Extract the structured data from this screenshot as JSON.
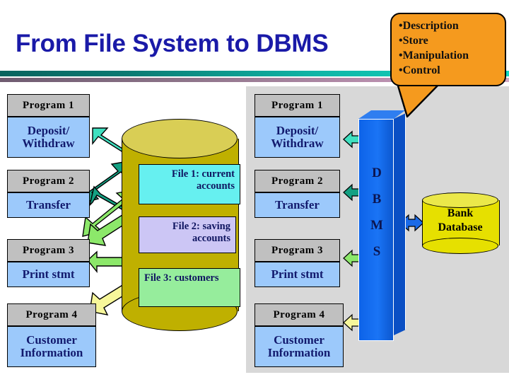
{
  "slide": {
    "title": "From File System to DBMS"
  },
  "callout": {
    "name": "dbms-functions-callout",
    "color": "#f59a1e",
    "items": [
      "Description",
      "Store",
      "Manipulation",
      "Control"
    ],
    "bullet": "•"
  },
  "left_column": {
    "label": "file-system-programs",
    "programs": [
      {
        "header": "Program 1",
        "body_lines": [
          "Deposit/",
          "Withdraw"
        ]
      },
      {
        "header": "Program 2",
        "body_lines": [
          "Transfer"
        ]
      },
      {
        "header": "Program 3",
        "body_lines": [
          "Print stmt"
        ]
      },
      {
        "header": "Program 4",
        "body_lines": [
          "Customer",
          "Information"
        ]
      }
    ]
  },
  "right_column": {
    "label": "dbms-programs",
    "programs": [
      {
        "header": "Program 1",
        "body_lines": [
          "Deposit/",
          "Withdraw"
        ]
      },
      {
        "header": "Program 2",
        "body_lines": [
          "Transfer"
        ]
      },
      {
        "header": "Program 3",
        "body_lines": [
          "Print stmt"
        ]
      },
      {
        "header": "Program 4",
        "body_lines": [
          "Customer",
          "Information"
        ]
      }
    ]
  },
  "file_cylinder": {
    "label": "file-system-store",
    "color": "#bfb000",
    "top_color": "#d9ce55",
    "files": [
      {
        "lines": [
          "File 1: current",
          "accounts"
        ],
        "color": "#66f0f0"
      },
      {
        "lines": [
          "File 2: saving",
          "accounts"
        ],
        "color": "#ccc6f5"
      },
      {
        "lines": [
          "File 3:",
          "customers"
        ],
        "color": "#96ed9c"
      }
    ]
  },
  "dbms": {
    "label": "DBMS",
    "letters": [
      "D",
      "B",
      "M",
      "S"
    ],
    "color": "#1a74f5"
  },
  "bank_database": {
    "lines": [
      "Bank",
      "Database"
    ],
    "color": "#e6e000"
  },
  "arrow_colors": {
    "teal_light": "#3fe0c0",
    "teal_dark": "#14a082",
    "green": "#8ce86a",
    "yellow": "#f7f79a",
    "blue": "#1a6ae8"
  },
  "banner": {
    "teal_from": "#09635e",
    "teal_to": "#12d9c2",
    "mauve_from": "#6f5b70",
    "mauve_to": "#d2a9c4"
  }
}
